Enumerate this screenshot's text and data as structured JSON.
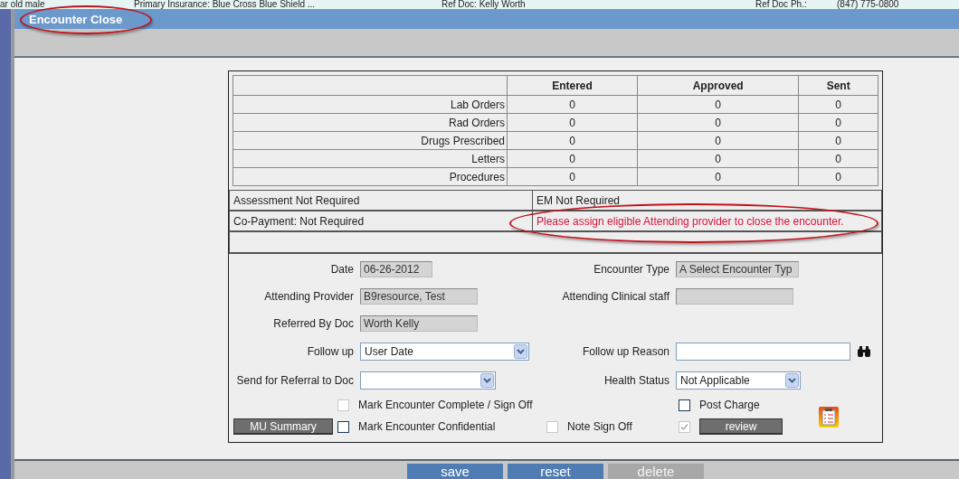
{
  "top_strip": [
    "ar old male",
    "Primary Insurance: Blue Cross Blue Shield ...",
    "Ref Doc: Kelly Worth",
    "Ref Doc Ph.:",
    "(847) 775-0800"
  ],
  "window": {
    "title": "Encounter Close"
  },
  "counts": {
    "columns": [
      "Entered",
      "Approved",
      "Sent"
    ],
    "rows": [
      {
        "label": "Lab Orders",
        "values": [
          "0",
          "0",
          "0"
        ]
      },
      {
        "label": "Rad Orders",
        "values": [
          "0",
          "0",
          "0"
        ]
      },
      {
        "label": "Drugs Prescribed",
        "values": [
          "0",
          "0",
          "0"
        ]
      },
      {
        "label": "Letters",
        "values": [
          "0",
          "0",
          "0"
        ]
      },
      {
        "label": "Procedures",
        "values": [
          "0",
          "0",
          "0"
        ]
      }
    ]
  },
  "status": {
    "assessment": "Assessment Not Required",
    "em": "EM Not Required",
    "copayment": "Co-Payment: Not Required",
    "message": "Please assign eligible Attending provider to close the encounter."
  },
  "form_rows": [
    {
      "left": {
        "label": "Date",
        "kind": "readonly",
        "value": "06-26-2012"
      },
      "right": {
        "label": "Encounter Type",
        "kind": "readonly",
        "value": "A Select Encounter Typ"
      }
    },
    {
      "left": {
        "label": "Attending Provider",
        "kind": "readonly",
        "value": "B9resource, Test"
      },
      "right": {
        "label": "Attending Clinical staff",
        "kind": "readonly"
      }
    },
    {
      "left": {
        "label": "Referred By Doc",
        "kind": "readonly",
        "value": "Worth Kelly"
      }
    },
    {
      "left": {
        "label": "Follow up",
        "kind": "select",
        "value": "User Date"
      },
      "right": {
        "label": "Follow up Reason",
        "kind": "search"
      }
    },
    {
      "left": {
        "label": "Send for Referral to Doc",
        "kind": "select"
      },
      "right": {
        "label": "Health Status",
        "kind": "select",
        "value": "Not Applicable"
      }
    }
  ],
  "mark_complete": {
    "label": "Mark Encounter Complete / Sign Off",
    "checked": false,
    "disabled": true
  },
  "post_charge": {
    "label": "Post Charge",
    "checked": false,
    "disabled": false
  },
  "mu_summary": "MU Summary",
  "mark_confidential": {
    "label": "Mark Encounter Confidential",
    "checked": false,
    "disabled": false
  },
  "note_sign_off": {
    "label": "Note Sign Off",
    "checked": false,
    "disabled": true
  },
  "review": {
    "label": "review",
    "checked": true,
    "disabled": true
  },
  "buttons": [
    {
      "label": "save",
      "disabled": false
    },
    {
      "label": "reset",
      "disabled": false
    },
    {
      "label": "delete",
      "disabled": true
    }
  ]
}
